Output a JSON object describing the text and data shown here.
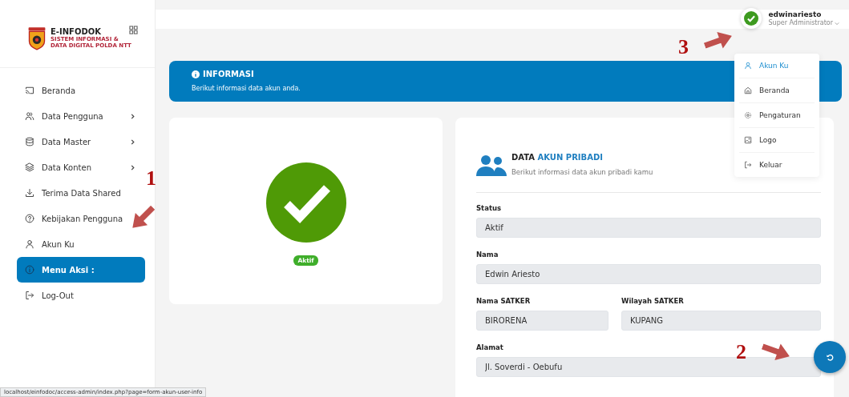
{
  "logo": {
    "title": "E-INFODOK",
    "subtitle_lines": [
      "SISTEM INFORMASI &",
      "DATA DIGITAL POLDA NTT"
    ]
  },
  "sidebar": {
    "items": [
      {
        "label": "Beranda",
        "has_submenu": false,
        "selected": false
      },
      {
        "label": "Data Pengguna",
        "has_submenu": true,
        "selected": false
      },
      {
        "label": "Data Master",
        "has_submenu": true,
        "selected": false
      },
      {
        "label": "Data Konten",
        "has_submenu": true,
        "selected": false
      },
      {
        "label": "Terima Data Shared",
        "has_submenu": false,
        "selected": false
      },
      {
        "label": "Kebijakan Pengguna",
        "has_submenu": false,
        "selected": false
      },
      {
        "label": "Akun Ku",
        "has_submenu": false,
        "selected": false
      },
      {
        "label": "Menu Aksi :",
        "has_submenu": false,
        "selected": true
      },
      {
        "label": "Log-Out",
        "has_submenu": false,
        "selected": false
      }
    ]
  },
  "header": {
    "username": "edwinariesto",
    "role": "Super Administrator"
  },
  "user_menu": {
    "items": [
      {
        "label": "Akun Ku",
        "selected": true
      },
      {
        "label": "Beranda",
        "selected": false
      },
      {
        "label": "Pengaturan",
        "selected": false
      },
      {
        "label": "Logo",
        "selected": false
      },
      {
        "label": "Keluar",
        "selected": false
      }
    ]
  },
  "info_banner": {
    "title": "INFORMASI",
    "text": "Berikut informasi data akun anda."
  },
  "status_card": {
    "badge": "Aktif"
  },
  "account_card": {
    "title_plain": "DATA",
    "title_accent": "AKUN PRIBADI",
    "subtitle": "Berikut informasi data akun pribadi kamu",
    "fields": [
      {
        "label": "Status",
        "value": "Aktif"
      },
      {
        "label": "Nama",
        "value": "Edwin Ariesto"
      },
      {
        "label": "Nama SATKER",
        "value": "BIRORENA"
      },
      {
        "label": "Wilayah SATKER",
        "value": "KUPANG"
      },
      {
        "label": "Alamat",
        "value": "Jl. Soverdi - Oebufu"
      }
    ]
  },
  "annotations": [
    {
      "label": "1"
    },
    {
      "label": "2"
    },
    {
      "label": "3"
    }
  ],
  "status_bar": {
    "url": "localhost/einfodoc/access-admin/index.php?page=form-akun-user-info"
  }
}
